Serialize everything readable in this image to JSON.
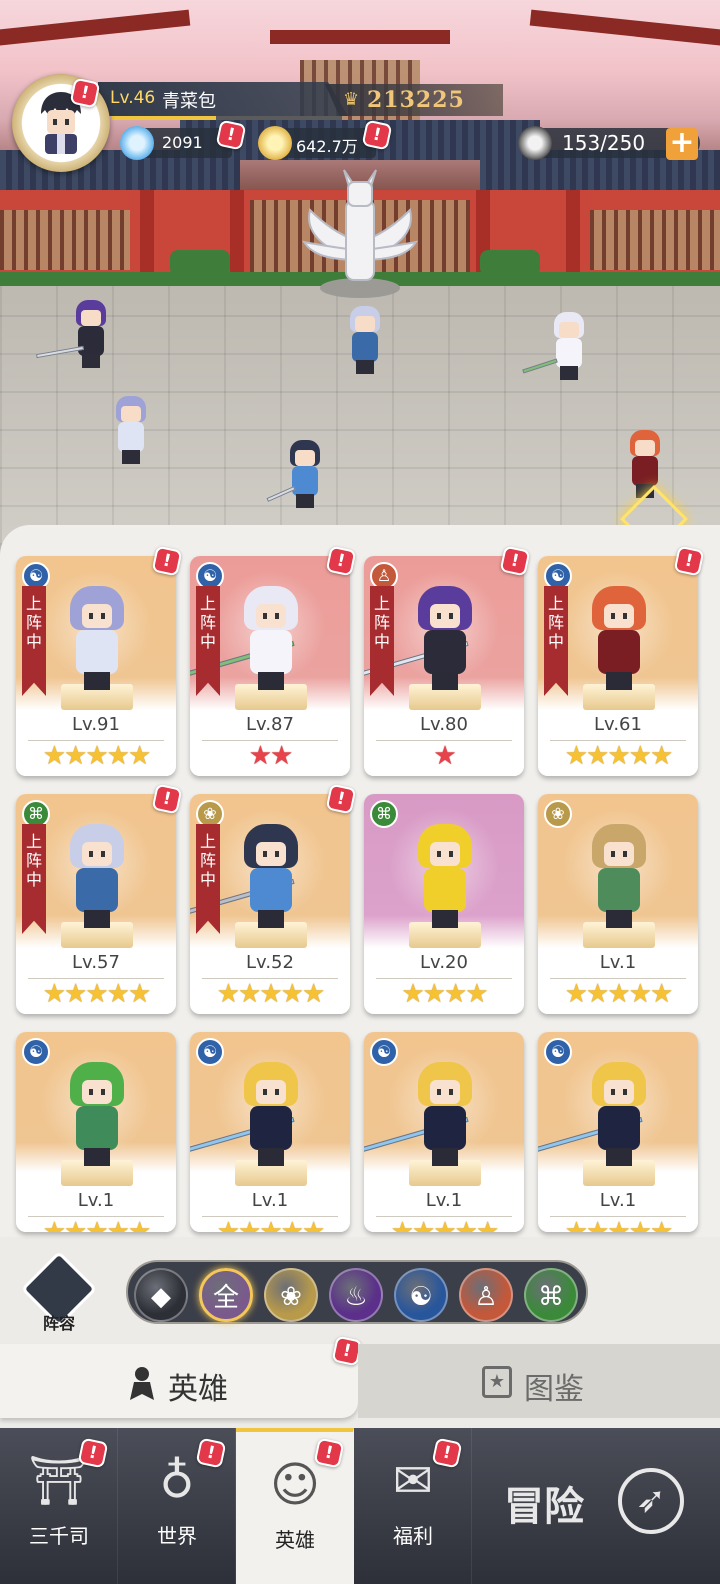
{
  "player": {
    "level": "Lv.46",
    "name": "青菜包",
    "power": "213225",
    "exp_fraction": 0.45
  },
  "resources": {
    "diamonds": "2091",
    "gold": "642.7万",
    "heroes_count": "153/250"
  },
  "alerts": {
    "mark": "!"
  },
  "hero_cards": [
    {
      "level": "Lv.91",
      "stars": "★★★★★",
      "star_color": "gold",
      "faction": "water",
      "in_lineup": true,
      "lineup_label": "上阵中",
      "alert": true,
      "bg": "tan"
    },
    {
      "level": "Lv.87",
      "stars": "★★",
      "star_color": "red",
      "faction": "water",
      "in_lineup": true,
      "lineup_label": "上阵中",
      "alert": true,
      "bg": "red"
    },
    {
      "level": "Lv.80",
      "stars": "★",
      "star_color": "red",
      "faction": "monk",
      "in_lineup": true,
      "lineup_label": "上阵中",
      "alert": true,
      "bg": "red"
    },
    {
      "level": "Lv.61",
      "stars": "★★★★★",
      "star_color": "gold",
      "faction": "water",
      "in_lineup": true,
      "lineup_label": "上阵中",
      "alert": true,
      "bg": "tan"
    },
    {
      "level": "Lv.57",
      "stars": "★★★★★",
      "star_color": "gold",
      "faction": "dna",
      "in_lineup": true,
      "lineup_label": "上阵中",
      "alert": true,
      "bg": "tan"
    },
    {
      "level": "Lv.52",
      "stars": "★★★★★",
      "star_color": "gold",
      "faction": "lotus",
      "in_lineup": true,
      "lineup_label": "上阵中",
      "alert": true,
      "bg": "tan"
    },
    {
      "level": "Lv.20",
      "stars": "★★★★",
      "star_color": "gold",
      "faction": "dna",
      "in_lineup": false,
      "alert": false,
      "bg": "pink"
    },
    {
      "level": "Lv.1",
      "stars": "★★★★★",
      "star_color": "gold",
      "faction": "lotus",
      "in_lineup": false,
      "alert": false,
      "bg": "tan"
    },
    {
      "level": "Lv.1",
      "stars": "★★★★★",
      "star_color": "gold",
      "faction": "water",
      "in_lineup": false,
      "alert": false,
      "bg": "tan"
    },
    {
      "level": "Lv.1",
      "stars": "★★★★★",
      "star_color": "gold",
      "faction": "water",
      "in_lineup": false,
      "alert": false,
      "bg": "tan"
    },
    {
      "level": "Lv.1",
      "stars": "★★★★★",
      "star_color": "gold",
      "faction": "water",
      "in_lineup": false,
      "alert": false,
      "bg": "tan"
    },
    {
      "level": "Lv.1",
      "stars": "★★★★★",
      "star_color": "gold",
      "faction": "water",
      "in_lineup": false,
      "alert": false,
      "bg": "tan"
    }
  ],
  "lineup_button": {
    "label": "阵容"
  },
  "filters": {
    "selected": "全",
    "items": [
      {
        "name": "diamond",
        "glyph": "◆",
        "color": "#2d2f36"
      },
      {
        "name": "all",
        "glyph": "全",
        "color": "#7a5a8c"
      },
      {
        "name": "lotus",
        "glyph": "❀",
        "color": "#b89a4a"
      },
      {
        "name": "flame",
        "glyph": "♨",
        "color": "#5b2f8a"
      },
      {
        "name": "water",
        "glyph": "☯",
        "color": "#28569c"
      },
      {
        "name": "monk",
        "glyph": "♙",
        "color": "#c4583a"
      },
      {
        "name": "dna",
        "glyph": "⌘",
        "color": "#3b8a3a"
      }
    ]
  },
  "sub_tabs": {
    "hero": "英雄",
    "handbook": "图鉴"
  },
  "bottom_nav": {
    "items": [
      {
        "label": "三千司",
        "icon": "palace-icon",
        "alert": true
      },
      {
        "label": "世界",
        "icon": "planet-icon",
        "alert": true
      },
      {
        "label": "英雄",
        "icon": "hero-icon",
        "alert": true
      },
      {
        "label": "福利",
        "icon": "gift-box-icon",
        "alert": true
      }
    ],
    "adventure": "冒险"
  },
  "colors": {
    "accent_gold": "#f0c640",
    "alert_red": "#e2384a",
    "ribbon_red": "#a72c2f"
  }
}
